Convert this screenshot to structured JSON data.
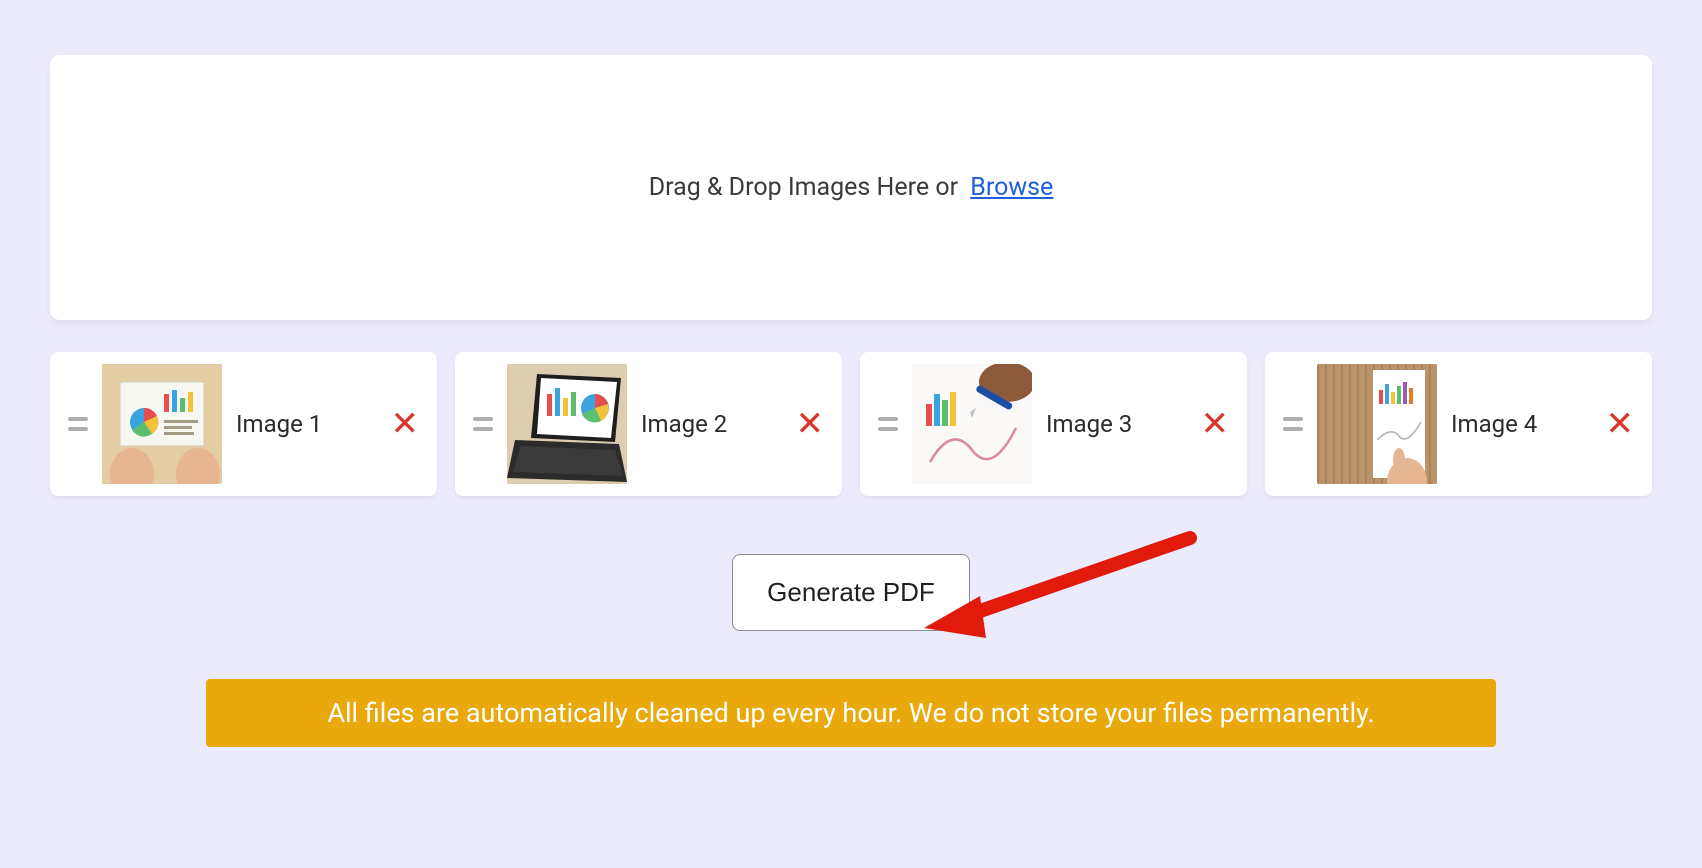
{
  "dropzone": {
    "text": "Drag & Drop Images Here or",
    "browse": "Browse"
  },
  "images": [
    {
      "label": "Image 1"
    },
    {
      "label": "Image 2"
    },
    {
      "label": "Image 3"
    },
    {
      "label": "Image 4"
    }
  ],
  "actions": {
    "generate": "Generate PDF"
  },
  "notice": "All files are automatically cleaned up every hour. We do not store your files permanently."
}
